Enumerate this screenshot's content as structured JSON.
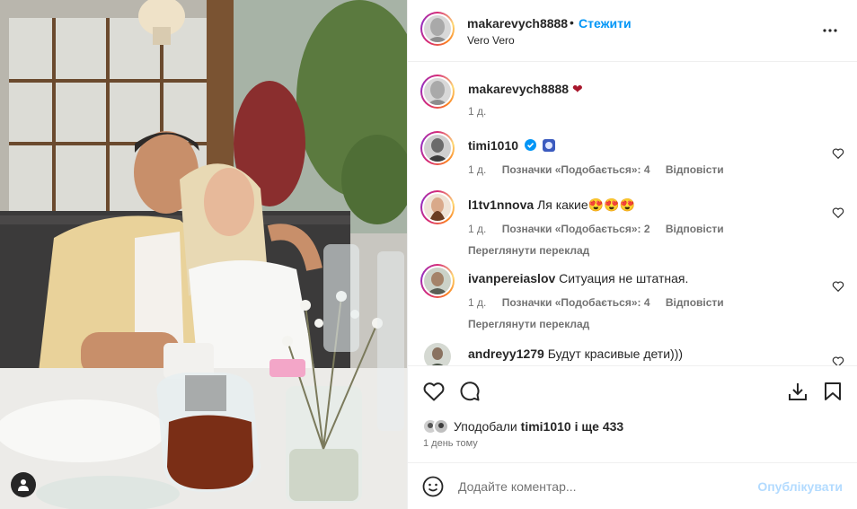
{
  "post": {
    "author": "makarevych8888",
    "dot": "•",
    "follow_label": "Стежити",
    "subtitle": "Vero Vero"
  },
  "caption": {
    "user": "makarevych8888",
    "text": "❤",
    "time": "1 д."
  },
  "comments": [
    {
      "user": "timi1010",
      "text": "",
      "verified": true,
      "time": "1 д.",
      "likes": "Позначки «Подобається»: 4",
      "reply": "Відповісти",
      "translate": ""
    },
    {
      "user": "l1tv1nnova",
      "text": "Ля какие😍😍😍",
      "verified": false,
      "time": "1 д.",
      "likes": "Позначки «Подобається»: 2",
      "reply": "Відповісти",
      "translate": "Переглянути переклад"
    },
    {
      "user": "ivanpereiaslov",
      "text": "Ситуация не штатная.",
      "verified": false,
      "time": "1 д.",
      "likes": "Позначки «Подобається»: 4",
      "reply": "Відповісти",
      "translate": "Переглянути переклад"
    },
    {
      "user": "andreyy1279",
      "text": "Будут красивые дети)))",
      "verified": false,
      "time": "",
      "likes": "",
      "reply": "",
      "translate": ""
    }
  ],
  "likes_summary": {
    "prefix": "Уподобали",
    "user": "timi1010",
    "suffix": "і ще 433"
  },
  "posted_ago": "1 день тому",
  "comment_input": {
    "placeholder": "Додайте коментар...",
    "publish_label": "Опублікувати"
  },
  "icons": {
    "more": "more-horizontal-icon",
    "like": "heart-outline-icon",
    "comment": "comment-bubble-icon",
    "download": "download-icon",
    "save": "bookmark-icon",
    "emoji": "smiley-icon",
    "user_tag": "user-tag-icon"
  },
  "colors": {
    "accent": "#0095f6",
    "publish_disabled": "#b3dbff",
    "muted": "#737373",
    "heart_red": "#a8172c"
  }
}
